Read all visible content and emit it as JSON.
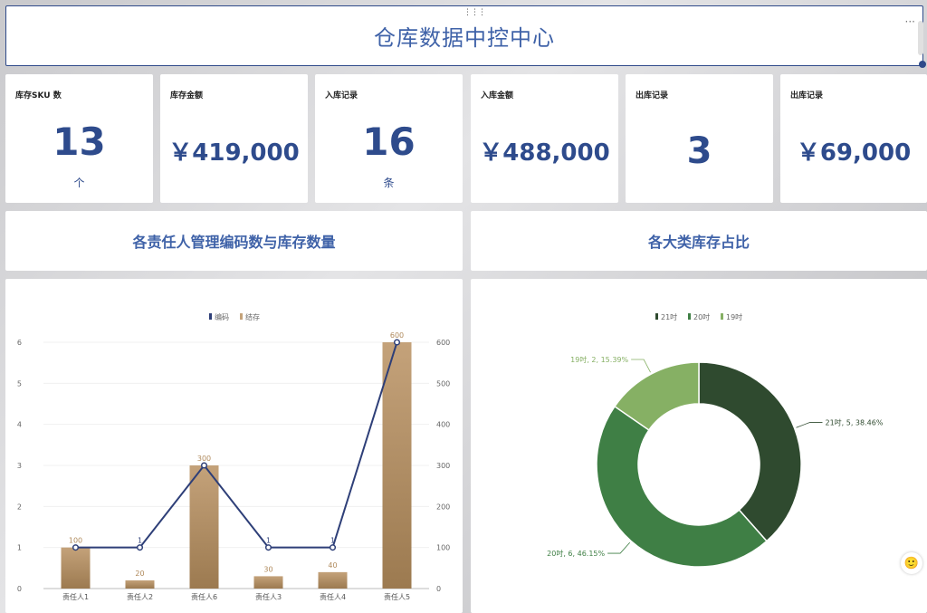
{
  "header": {
    "title": "仓库数据中控中心"
  },
  "kpis": [
    {
      "label": "库存SKU 数",
      "value": "13",
      "unit": "个"
    },
    {
      "label": "库存金额",
      "value": "￥419,000"
    },
    {
      "label": "入库记录",
      "value": "16",
      "unit": "条"
    },
    {
      "label": "入库金额",
      "value": "￥488,000"
    },
    {
      "label": "出库记录",
      "value": "3"
    },
    {
      "label": "出库记录",
      "value": "￥69,000"
    }
  ],
  "sections": {
    "left_title": "各责任人管理编码数与库存数量",
    "right_title": "各大类库存占比"
  },
  "colors": {
    "accent": "#3f62a8",
    "line": "#2e3f78",
    "bar_top": "#c4a27a",
    "bar_bottom": "#9c7a50",
    "bar_label": "#b08a5c",
    "pie": [
      "#2f4a2f",
      "#3f7f45",
      "#86b064"
    ]
  },
  "chart_data": [
    {
      "type": "bar",
      "categories": [
        "责任人1",
        "责任人2",
        "责任人6",
        "责任人3",
        "责任人4",
        "责任人5"
      ],
      "series": [
        {
          "name": "编码",
          "type": "line",
          "axis": "left",
          "values": [
            1,
            1,
            3,
            1,
            1,
            6
          ]
        },
        {
          "name": "结存",
          "type": "bar",
          "axis": "right",
          "values": [
            100,
            20,
            300,
            30,
            40,
            600
          ]
        }
      ],
      "y_left": {
        "ticks": [
          0,
          1,
          2,
          3,
          4,
          5,
          6
        ],
        "ylim": [
          0,
          6
        ]
      },
      "y_right": {
        "ticks": [
          0,
          100,
          200,
          300,
          400,
          500,
          600
        ],
        "ylim": [
          0,
          600
        ]
      },
      "legend": "top-center",
      "grid": true
    },
    {
      "type": "pie",
      "donut": true,
      "slices": [
        {
          "name": "21吋",
          "value": 5,
          "percent": 38.46,
          "label": "21吋, 5, 38.46%"
        },
        {
          "name": "20吋",
          "value": 6,
          "percent": 46.15,
          "label": "20吋, 6, 46.15%"
        },
        {
          "name": "19吋",
          "value": 2,
          "percent": 15.39,
          "label": "19吋, 2, 15.39%"
        }
      ],
      "legend": "top-center"
    }
  ]
}
